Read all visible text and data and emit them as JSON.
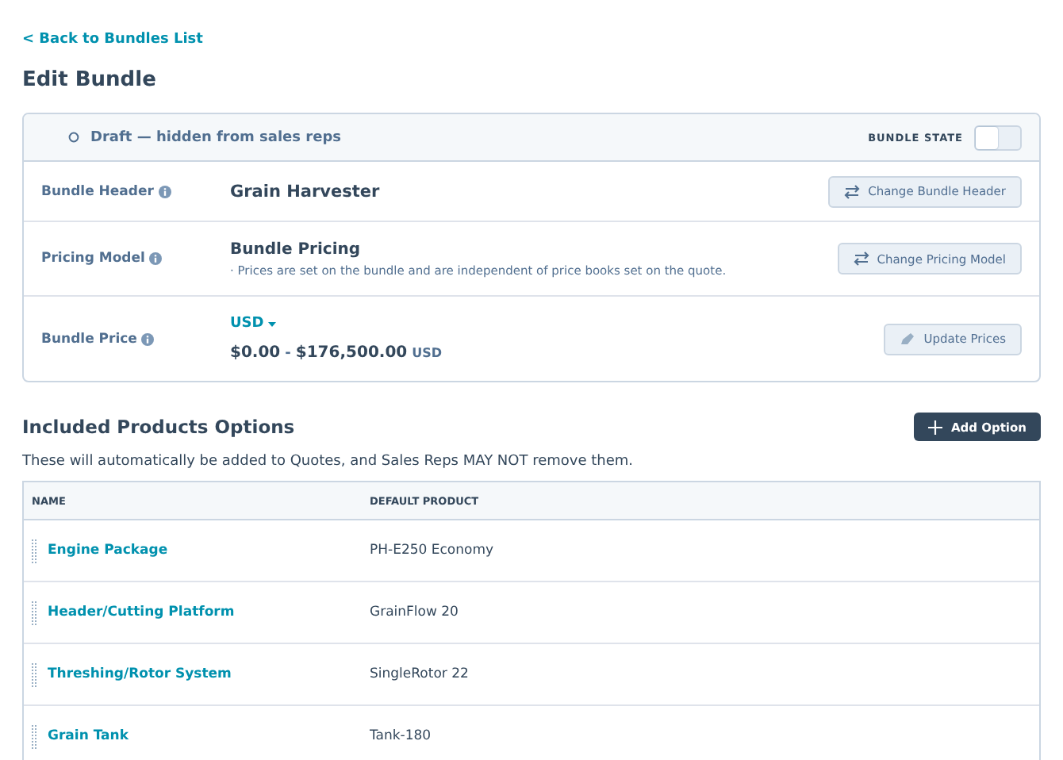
{
  "back_link": "< Back to Bundles List",
  "title": "Edit Bundle",
  "status": {
    "text": "Draft — hidden from sales reps",
    "state_label": "BUNDLE STATE",
    "on": false
  },
  "fields": [
    {
      "kind": "header",
      "label": "Bundle Header",
      "value": "Grain Harvester",
      "button": "Change Bundle Header"
    },
    {
      "kind": "pricing",
      "label": "Pricing Model",
      "value": "Bundle Pricing",
      "note": "· Prices are set on the bundle and are independent of price books set on the quote.",
      "button": "Change Pricing Model"
    },
    {
      "kind": "price",
      "label": "Bundle Price",
      "currency": "USD",
      "low": "$0.00",
      "separator": "-",
      "high": "$176,500.00",
      "unit": "USD",
      "button": "Update Prices"
    }
  ],
  "section": {
    "title": "Included Products Options",
    "button": "Add Option",
    "description": "These will automatically be added to Quotes, and Sales Reps MAY NOT remove them."
  },
  "table": {
    "columns": [
      "NAME",
      "DEFAULT PRODUCT"
    ],
    "rows": [
      {
        "name": "Engine Package",
        "product": "PH-E250 Economy"
      },
      {
        "name": "Header/Cutting Platform",
        "product": "GrainFlow 20"
      },
      {
        "name": "Threshing/Rotor System",
        "product": "SingleRotor 22"
      },
      {
        "name": "Grain Tank",
        "product": "Tank-180"
      }
    ]
  }
}
